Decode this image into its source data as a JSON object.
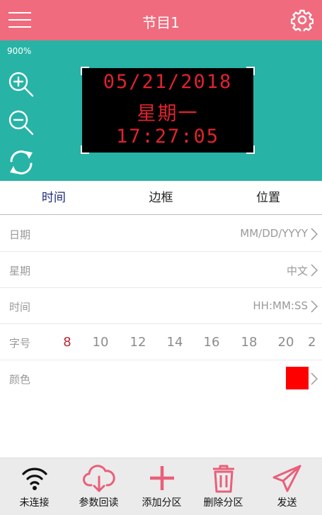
{
  "header": {
    "title": "节目1",
    "menu_icon": "hamburger-menu-icon",
    "settings_icon": "gear-icon"
  },
  "preview": {
    "zoom": "900%",
    "led_lines": [
      "05/21/2018",
      "星期一",
      "17:27:05"
    ],
    "led_color": "#e0222c",
    "background_color": "#27b3a5"
  },
  "tabs": [
    {
      "label": "时间",
      "active": true
    },
    {
      "label": "边框",
      "active": false
    },
    {
      "label": "位置",
      "active": false
    }
  ],
  "settings": {
    "date": {
      "label": "日期",
      "value": "MM/DD/YYYY"
    },
    "weekday": {
      "label": "星期",
      "value": "中文"
    },
    "time": {
      "label": "时间",
      "value": "HH:MM:SS"
    },
    "font_size": {
      "label": "字号",
      "options": [
        "8",
        "10",
        "12",
        "14",
        "16",
        "18",
        "20",
        "2"
      ],
      "selected": "8"
    },
    "color": {
      "label": "颜色",
      "value": "#ff0000"
    }
  },
  "toolbar": [
    {
      "label": "未连接",
      "icon": "wifi-icon"
    },
    {
      "label": "参数回读",
      "icon": "cloud-download-icon"
    },
    {
      "label": "添加分区",
      "icon": "plus-icon"
    },
    {
      "label": "删除分区",
      "icon": "trash-icon"
    },
    {
      "label": "发送",
      "icon": "send-icon"
    }
  ],
  "colors": {
    "header": "#f06b7d",
    "accent_pink": "#e8607a",
    "tab_active": "#1e2a78"
  }
}
